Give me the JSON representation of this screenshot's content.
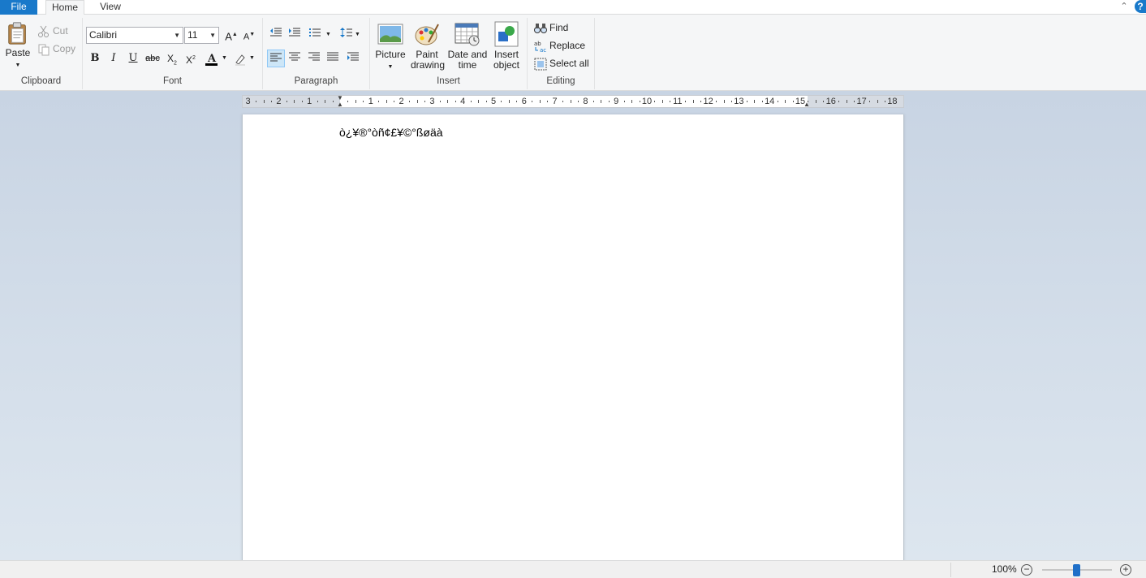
{
  "tabs": {
    "file": "File",
    "home": "Home",
    "view": "View"
  },
  "ribbon": {
    "clipboard": {
      "label": "Clipboard",
      "paste": "Paste",
      "cut": "Cut",
      "copy": "Copy"
    },
    "font": {
      "label": "Font",
      "family": "Calibri",
      "size": "11"
    },
    "paragraph": {
      "label": "Paragraph"
    },
    "insert": {
      "label": "Insert",
      "picture": "Picture",
      "paint_line1": "Paint",
      "paint_line2": "drawing",
      "date_line1": "Date and",
      "date_line2": "time",
      "object_line1": "Insert",
      "object_line2": "object"
    },
    "editing": {
      "label": "Editing",
      "find": "Find",
      "replace": "Replace",
      "select_all": "Select all"
    }
  },
  "ruler": {
    "labels": [
      "3",
      "2",
      "1",
      "1",
      "2",
      "3",
      "4",
      "5",
      "6",
      "7",
      "8",
      "9",
      "10",
      "11",
      "12",
      "13",
      "14",
      "15",
      "16",
      "17",
      "18"
    ]
  },
  "document": {
    "text": "ò¿¥®°òñ¢£¥©°ßøäà"
  },
  "status": {
    "zoom": "100%"
  },
  "colors": {
    "accent": "#1979ca",
    "font_color_bar": "#000000",
    "highlight_bar": "#ffffff"
  }
}
